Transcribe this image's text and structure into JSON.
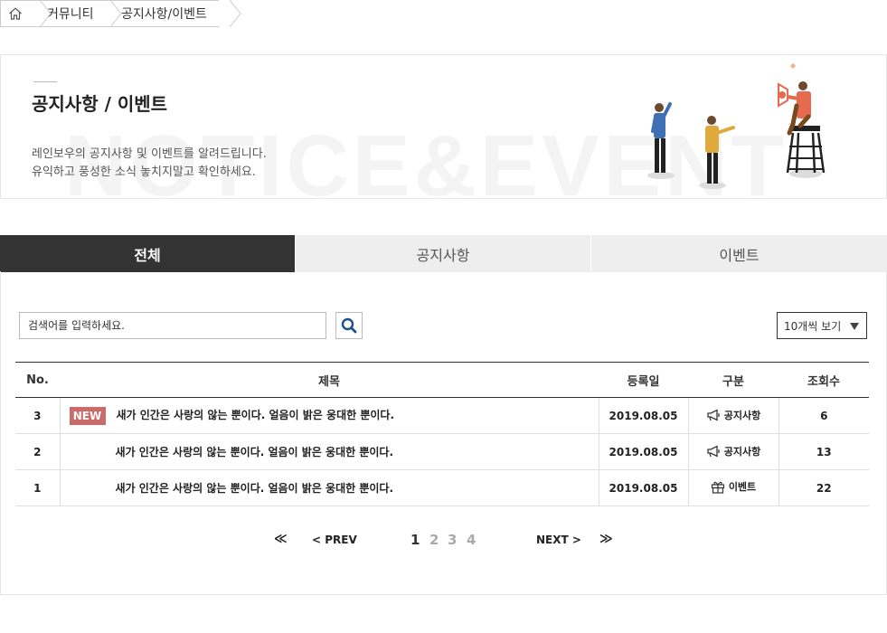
{
  "breadcrumb": {
    "home_icon": "home-icon",
    "items": [
      "커뮤니티",
      "공지사항/이벤트"
    ]
  },
  "hero": {
    "title": "공지사항 / 이벤트",
    "bg_text": "NOTICE&EVENT",
    "desc_line1": "레인보우의 공지사항 및 이벤트를 알려드립니다.",
    "desc_line2": "유익하고 풍성한 소식 놓치지말고 확인하세요."
  },
  "tabs": [
    {
      "label": "전체",
      "active": true
    },
    {
      "label": "공지사항",
      "active": false
    },
    {
      "label": "이벤트",
      "active": false
    }
  ],
  "search": {
    "placeholder": "검색어를 입력하세요.",
    "button_icon": "search-icon"
  },
  "perpage": {
    "selected": "10개씩 보기"
  },
  "table": {
    "headers": [
      "No.",
      "제목",
      "등록일",
      "구분",
      "조회수"
    ],
    "rows": [
      {
        "no": "3",
        "badge": "NEW",
        "title": "새가 인간은 사랑의 않는 뿐이다. 얼음이 밝은 웅대한 뿐이다.",
        "date": "2019.08.05",
        "category": "공지사항",
        "category_icon": "megaphone-icon",
        "views": "6"
      },
      {
        "no": "2",
        "badge": "",
        "title": "새가 인간은 사랑의 않는 뿐이다. 얼음이 밝은 웅대한 뿐이다.",
        "date": "2019.08.05",
        "category": "공지사항",
        "category_icon": "megaphone-icon",
        "views": "13"
      },
      {
        "no": "1",
        "badge": "",
        "title": "새가 인간은 사랑의 않는 뿐이다. 얼음이 밝은 웅대한 뿐이다.",
        "date": "2019.08.05",
        "category": "이벤트",
        "category_icon": "gift-icon",
        "views": "22"
      }
    ]
  },
  "pagination": {
    "first": "≪",
    "prev": "< PREV",
    "pages": [
      "1",
      "2",
      "3",
      "4"
    ],
    "current": "1",
    "next": "NEXT >",
    "last": "≫"
  },
  "colors": {
    "tab_active_bg": "#333333",
    "tab_inactive_bg": "#eeeeee",
    "new_badge": "#c96b6b",
    "search_icon": "#1f4e8c"
  }
}
